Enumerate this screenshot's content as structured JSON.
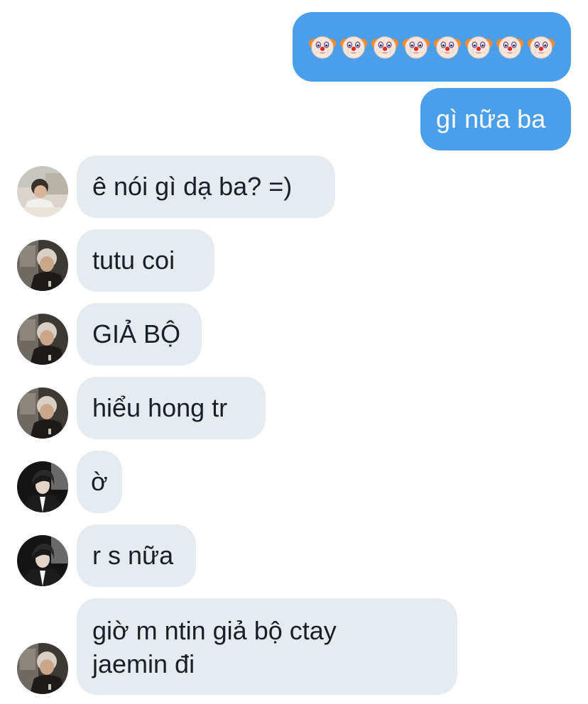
{
  "messages": [
    {
      "id": "m1",
      "direction": "outgoing",
      "type": "emoji",
      "emoji": "clown-face",
      "count": 8
    },
    {
      "id": "m2",
      "direction": "outgoing",
      "text": "gì nữa ba"
    },
    {
      "id": "m3",
      "direction": "incoming",
      "sender_avatar": "avatar-a",
      "text": "ê nói gì dạ ba? =)"
    },
    {
      "id": "m4",
      "direction": "incoming",
      "sender_avatar": "avatar-b",
      "text": "tutu coi"
    },
    {
      "id": "m5",
      "direction": "incoming",
      "sender_avatar": "avatar-b",
      "text": "GIẢ BỘ"
    },
    {
      "id": "m6",
      "direction": "incoming",
      "sender_avatar": "avatar-b",
      "text": "hiểu hong tr"
    },
    {
      "id": "m7",
      "direction": "incoming",
      "sender_avatar": "avatar-c",
      "text": "ờ"
    },
    {
      "id": "m8",
      "direction": "incoming",
      "sender_avatar": "avatar-c",
      "text": "r s nữa"
    },
    {
      "id": "m9",
      "direction": "incoming",
      "sender_avatar": "avatar-b",
      "text_line1": "giờ m ntin giả bộ ctay",
      "text_line2": "jaemin đi"
    }
  ],
  "colors": {
    "outgoing_bubble": "#4a9eea",
    "incoming_bubble": "#e6ebef",
    "incoming_text": "#15202b",
    "outgoing_text": "#ffffff"
  }
}
